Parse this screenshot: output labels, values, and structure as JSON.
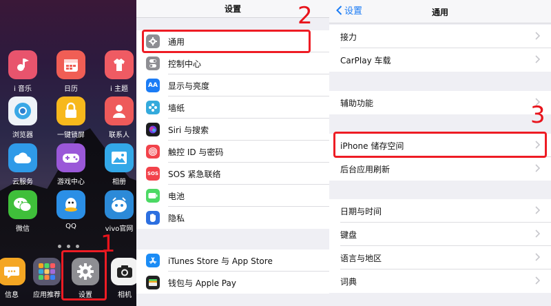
{
  "home": {
    "apps": [
      {
        "label": "i 音乐",
        "icon": "music-icon",
        "color": "#e8546d"
      },
      {
        "label": "日历",
        "icon": "calendar-icon",
        "color": "#f05e55"
      },
      {
        "label": "i 主题",
        "icon": "theme-icon",
        "color": "#ef5b63"
      },
      {
        "label": "浏览器",
        "icon": "browser-icon",
        "color": "#3aa8e6"
      },
      {
        "label": "一键锁屏",
        "icon": "lock-icon",
        "color": "#f7b81c"
      },
      {
        "label": "联系人",
        "icon": "contacts-icon",
        "color": "#ee5a5a"
      },
      {
        "label": "云服务",
        "icon": "cloud-icon",
        "color": "#2f9ae8"
      },
      {
        "label": "游戏中心",
        "icon": "gamepad-icon",
        "color": "#9a58d8"
      },
      {
        "label": "相册",
        "icon": "photos-icon",
        "color": "#33a8e8"
      },
      {
        "label": "微信",
        "icon": "wechat-icon",
        "color": "#3fbf3a"
      },
      {
        "label": "QQ",
        "icon": "qq-icon",
        "color": "#2b8fe6"
      },
      {
        "label": "vivo官网",
        "icon": "vivo-icon",
        "color": "#2c8ad8"
      }
    ],
    "dock": [
      {
        "label": "信息",
        "icon": "message-icon",
        "color": "#f4a623"
      },
      {
        "label": "应用推荐",
        "icon": "app-store-icon",
        "color": "#5a5870"
      },
      {
        "label": "设置",
        "icon": "settings-gear-icon",
        "color": "#8e8e93"
      },
      {
        "label": "相机",
        "icon": "camera-icon",
        "color": "#f2f2f2"
      }
    ]
  },
  "settings": {
    "title": "设置",
    "rows": [
      {
        "label": "通用",
        "icon": "gear-icon",
        "color": "#8e8e93"
      },
      {
        "label": "控制中心",
        "icon": "control-center-icon",
        "color": "#8e8e93"
      },
      {
        "label": "显示与亮度",
        "icon": "display-icon",
        "color": "#1b7cf5",
        "glyph": "AA"
      },
      {
        "label": "墙纸",
        "icon": "wallpaper-icon",
        "color": "#34aadc"
      },
      {
        "label": "Siri 与搜索",
        "icon": "siri-icon",
        "color": "#1c1c1e"
      },
      {
        "label": "触控 ID 与密码",
        "icon": "fingerprint-icon",
        "color": "#f2434b"
      },
      {
        "label": "SOS 紧急联络",
        "icon": "sos-icon",
        "color": "#f2434b",
        "glyph": "SOS"
      },
      {
        "label": "电池",
        "icon": "battery-icon",
        "color": "#4cd964"
      },
      {
        "label": "隐私",
        "icon": "privacy-hand-icon",
        "color": "#2c6fe0"
      },
      {
        "label": "iTunes Store 与 App Store",
        "icon": "app-store-icon",
        "color": "#1b8cf5"
      },
      {
        "label": "钱包与 Apple Pay",
        "icon": "wallet-icon",
        "color": "#222222"
      }
    ]
  },
  "general": {
    "back_label": "设置",
    "title": "通用",
    "rows": [
      {
        "label": "接力"
      },
      {
        "label": "CarPlay 车载"
      },
      {
        "label": "辅助功能"
      },
      {
        "label": "iPhone 储存空间"
      },
      {
        "label": "后台应用刷新"
      },
      {
        "label": "日期与时间"
      },
      {
        "label": "键盘"
      },
      {
        "label": "语言与地区"
      },
      {
        "label": "词典"
      }
    ]
  },
  "steps": [
    "1",
    "2",
    "3"
  ],
  "highlight_color": "#ee1c24"
}
